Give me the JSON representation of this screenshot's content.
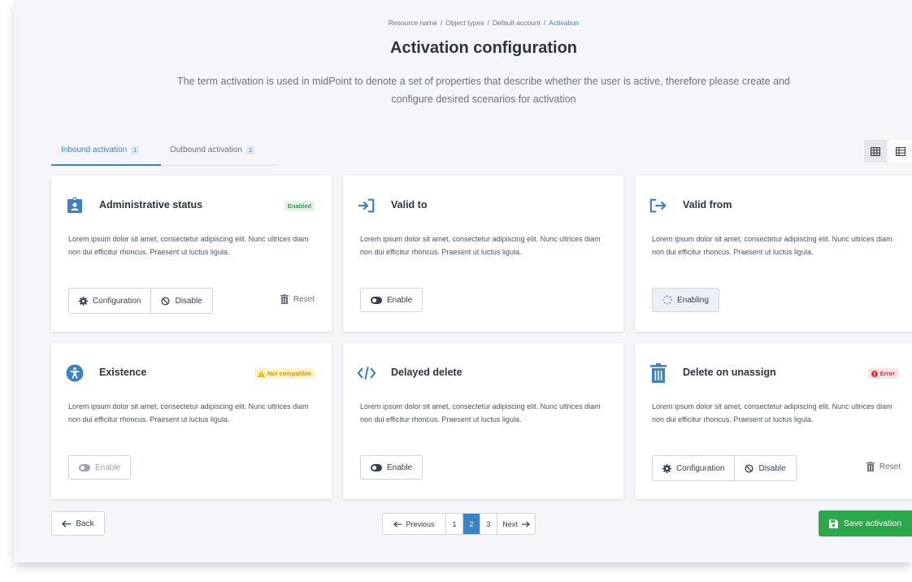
{
  "breadcrumb": {
    "items": [
      "Resource name",
      "Object types",
      "Default account"
    ],
    "current": "Activation",
    "separator": "/"
  },
  "page": {
    "title": "Activation configuration",
    "description": "The term activation is used in midPoint to denote a set of properties that describe whether the user is active, therefore please create and configure desired scenarios for activation"
  },
  "tabs": [
    {
      "label": "Inbound activation",
      "count": "1",
      "active": true
    },
    {
      "label": "Outbound activation",
      "count": "1",
      "active": false
    }
  ],
  "view_toggle": {
    "active": "grid"
  },
  "cards": [
    {
      "title": "Administrative status",
      "icon": "id-badge-icon",
      "badge": {
        "label": "Enabled",
        "type": "success"
      },
      "text": "Lorem ipsum dolor sit amet, consectetur adipiscing elit. Nunc ultrices diam non dui efficitur rhoncus. Praesent ut luctus ligula.",
      "actions": {
        "configuration": "Configuration",
        "disable": "Disable",
        "reset": "Reset"
      }
    },
    {
      "title": "Valid to",
      "icon": "sign-in-icon",
      "text": "Lorem ipsum dolor sit amet, consectetur adipiscing elit. Nunc ultrices diam non dui efficitur rhoncus. Praesent ut luctus ligula.",
      "actions": {
        "enable": "Enable"
      }
    },
    {
      "title": "Valid from",
      "icon": "sign-out-icon",
      "text": "Lorem ipsum dolor sit amet, consectetur adipiscing elit. Nunc ultrices diam non dui efficitur rhoncus. Praesent ut luctus ligula.",
      "actions": {
        "enabling": "Enabling"
      }
    },
    {
      "title": "Existence",
      "icon": "accessibility-icon",
      "badge": {
        "label": "Not compatible",
        "type": "warning"
      },
      "text": "Lorem ipsum dolor sit amet, consectetur adipiscing elit. Nunc ultrices diam non dui efficitur rhoncus. Praesent ut luctus ligula.",
      "actions": {
        "enable": "Enable"
      }
    },
    {
      "title": "Delayed delete",
      "icon": "code-icon",
      "text": "Lorem ipsum dolor sit amet, consectetur adipiscing elit. Nunc ultrices diam non dui efficitur rhoncus. Praesent ut luctus ligula.",
      "actions": {
        "enable": "Enable"
      }
    },
    {
      "title": "Delete on unassign",
      "icon": "trash-icon",
      "badge": {
        "label": "Error",
        "type": "danger"
      },
      "text": "Lorem ipsum dolor sit amet, consectetur adipiscing elit. Nunc ultrices diam non dui efficitur rhoncus. Praesent ut luctus ligula.",
      "actions": {
        "configuration": "Configuration",
        "disable": "Disable",
        "reset": "Reset"
      }
    }
  ],
  "footer": {
    "back": "Back",
    "pagination": {
      "previous": "Previous",
      "next": "Next",
      "pages": [
        "1",
        "2",
        "3"
      ],
      "current": "2"
    },
    "save": "Save activation"
  },
  "colors": {
    "accent": "#3b82c4",
    "success": "#2aa84a",
    "warning": "#f5b400",
    "danger": "#d33b3b"
  }
}
